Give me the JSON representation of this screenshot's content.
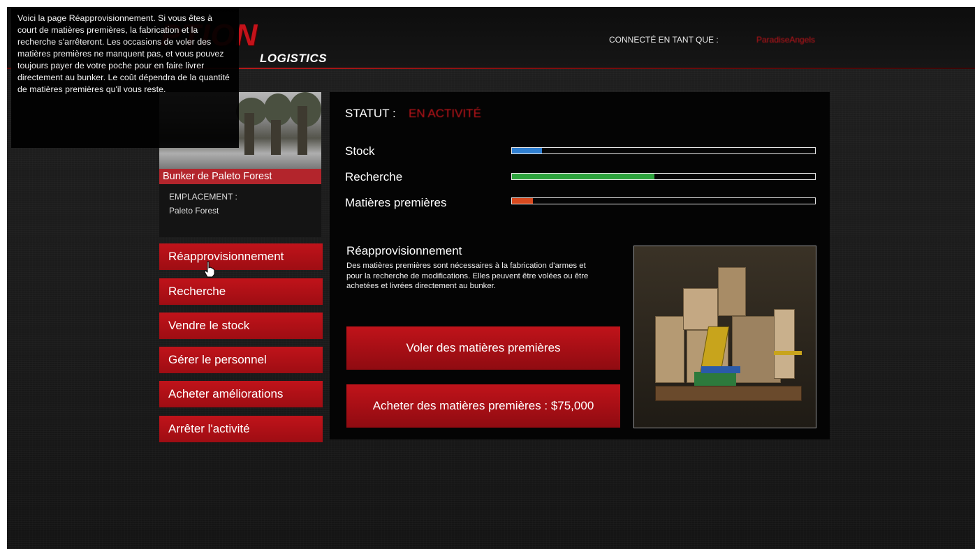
{
  "colors": {
    "accent": "#c4121a",
    "button": "#b0101a",
    "panel": "#040404",
    "stock_bar": "#2f7fd1",
    "research_bar": "#2ea33e",
    "supplies_bar": "#d84a1f"
  },
  "header": {
    "logo_main": "PTION",
    "logo_sub": "LOGISTICS",
    "connected_label": "CONNECTÉ EN TANT QUE :",
    "username": "ParadiseAngels"
  },
  "tooltip": {
    "text": "Voici la page Réapprovisionnement. Si vous êtes à court de matières premières, la fabrication et la recherche s'arrêteront. Les occasions de voler des matières premières ne manquent pas, et vous pouvez toujours payer de votre poche pour en faire livrer directement au bunker. Le coût dépendra de la quantité de matières premières qu'il vous reste."
  },
  "property": {
    "name": "Bunker de Paleto Forest",
    "location_label": "EMPLACEMENT :",
    "location_value": "Paleto Forest"
  },
  "menu": [
    {
      "label": "Réapprovisionnement"
    },
    {
      "label": "Recherche"
    },
    {
      "label": "Vendre le stock"
    },
    {
      "label": "Gérer le personnel"
    },
    {
      "label": "Acheter améliorations"
    },
    {
      "label": "Arrêter l'activité"
    }
  ],
  "status": {
    "label": "STATUT :",
    "value": "EN ACTIVITÉ"
  },
  "bars": [
    {
      "label": "Stock",
      "level": 0.1
    },
    {
      "label": "Recherche",
      "level": 0.47
    },
    {
      "label": "Matières premières",
      "level": 0.07
    }
  ],
  "resupply": {
    "title": "Réapprovisionnement",
    "description": "Des matières premières sont nécessaires à la fabrication d'armes et pour la recherche de modifications. Elles peuvent être volées ou être achetées et livrées directement au bunker.",
    "steal_button": "Voler des matières premières",
    "buy_button": "Acheter des matières premières : $75,000"
  }
}
